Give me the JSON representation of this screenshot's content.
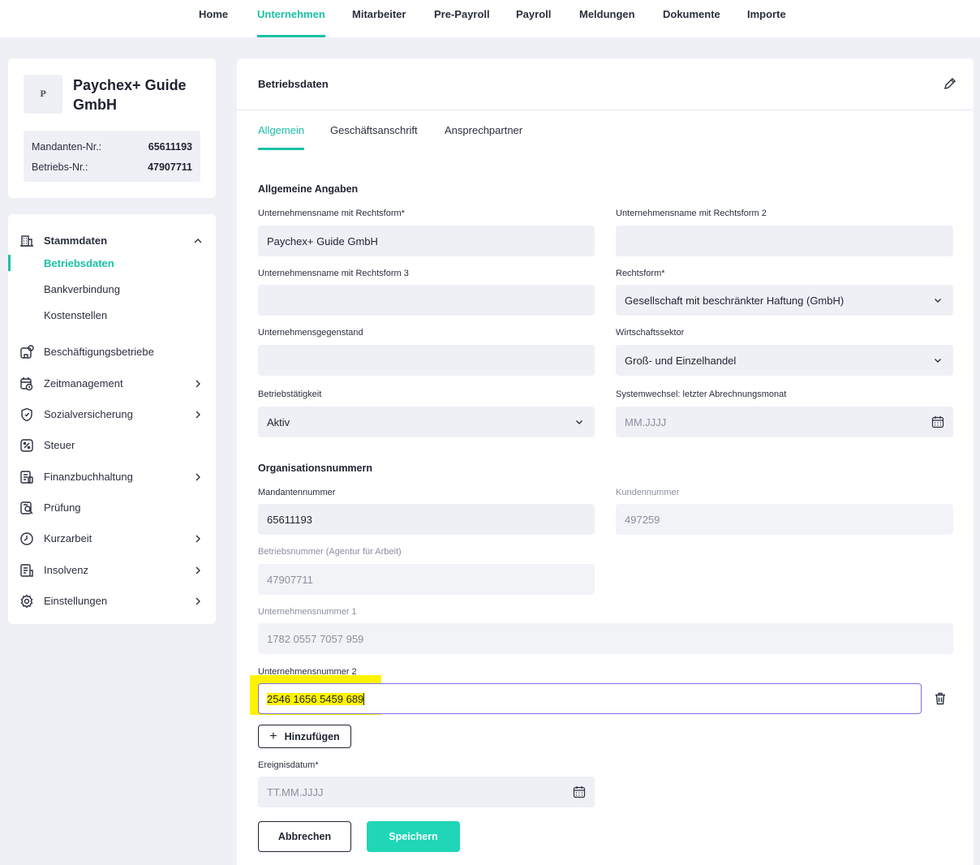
{
  "nav": {
    "items": [
      {
        "label": "Home",
        "active": false
      },
      {
        "label": "Unternehmen",
        "active": true
      },
      {
        "label": "Mitarbeiter",
        "active": false
      },
      {
        "label": "Pre-Payroll",
        "active": false
      },
      {
        "label": "Payroll",
        "active": false
      },
      {
        "label": "Meldungen",
        "active": false
      },
      {
        "label": "Dokumente",
        "active": false
      },
      {
        "label": "Importe",
        "active": false
      }
    ]
  },
  "company": {
    "logo_text": "P",
    "name": "Paychex+ Guide GmbH",
    "mandant_label": "Mandanten-Nr.:",
    "mandant_value": "65611193",
    "betrieb_label": "Betriebs-Nr.:",
    "betrieb_value": "47907711"
  },
  "sidebar": {
    "section": {
      "label": "Stammdaten",
      "icon": "building-icon",
      "expanded": true
    },
    "subitems": [
      {
        "label": "Betriebsdaten",
        "active": true
      },
      {
        "label": "Bankverbindung",
        "active": false
      },
      {
        "label": "Kostenstellen",
        "active": false
      }
    ],
    "items": [
      {
        "label": "Beschäftigungsbetriebe",
        "icon": "buildings-icon",
        "chevron": false
      },
      {
        "label": "Zeitmanagement",
        "icon": "calendar-clock-icon",
        "chevron": true
      },
      {
        "label": "Sozialversicherung",
        "icon": "shield-icon",
        "chevron": true
      },
      {
        "label": "Steuer",
        "icon": "tax-icon",
        "chevron": false
      },
      {
        "label": "Finanzbuchhaltung",
        "icon": "ledger-icon",
        "chevron": true
      },
      {
        "label": "Prüfung",
        "icon": "audit-icon",
        "chevron": false
      },
      {
        "label": "Kurzarbeit",
        "icon": "clock-icon",
        "chevron": true
      },
      {
        "label": "Insolvenz",
        "icon": "document-icon",
        "chevron": true
      },
      {
        "label": "Einstellungen",
        "icon": "gear-icon",
        "chevron": true
      }
    ]
  },
  "main": {
    "title": "Betriebsdaten",
    "tabs": [
      {
        "label": "Allgemein",
        "active": true
      },
      {
        "label": "Geschäftsanschrift",
        "active": false
      },
      {
        "label": "Ansprechpartner",
        "active": false
      }
    ],
    "general": {
      "title": "Allgemeine Angaben",
      "name1_label": "Unternehmensname mit Rechtsform*",
      "name1_value": "Paychex+ Guide GmbH",
      "name2_label": "Unternehmensname mit Rechtsform 2",
      "name2_value": "",
      "name3_label": "Unternehmensname mit Rechtsform 3",
      "name3_value": "",
      "rechtsform_label": "Rechtsform*",
      "rechtsform_value": "Gesellschaft mit beschränkter Haftung (GmbH)",
      "gegenstand_label": "Unternehmensgegenstand",
      "gegenstand_value": "",
      "sektor_label": "Wirtschaftssektor",
      "sektor_value": "Groß- und Einzelhandel",
      "taetigkeit_label": "Betriebstätigkeit",
      "taetigkeit_value": "Aktiv",
      "systemwechsel_label": "Systemwechsel: letzter Abrechnungsmonat",
      "systemwechsel_placeholder": "MM.JJJJ"
    },
    "org": {
      "title": "Organisationsnummern",
      "mandant_label": "Mandantennummer",
      "mandant_value": "65611193",
      "kunde_label": "Kundennummer",
      "kunde_value": "497259",
      "betrieb_label": "Betriebsnummer (Agentur für Arbeit)",
      "betrieb_value": "47907711",
      "unr1_label": "Unternehmensnummer 1",
      "unr1_value": "1782 0557 7057 959",
      "unr2_label": "Unternehmensnummer 2",
      "unr2_value": "2546 1656 5459 689",
      "add_label": "Hinzufügen",
      "ereignis_label": "Ereignisdatum*",
      "ereignis_placeholder": "TT.MM.JJJJ"
    },
    "actions": {
      "cancel": "Abbrechen",
      "save": "Speichern"
    }
  },
  "colors": {
    "accent": "#19c1a6",
    "primary_button": "#1fd6b6",
    "highlight": "#fff200",
    "focus_border": "#7b6ff0"
  }
}
